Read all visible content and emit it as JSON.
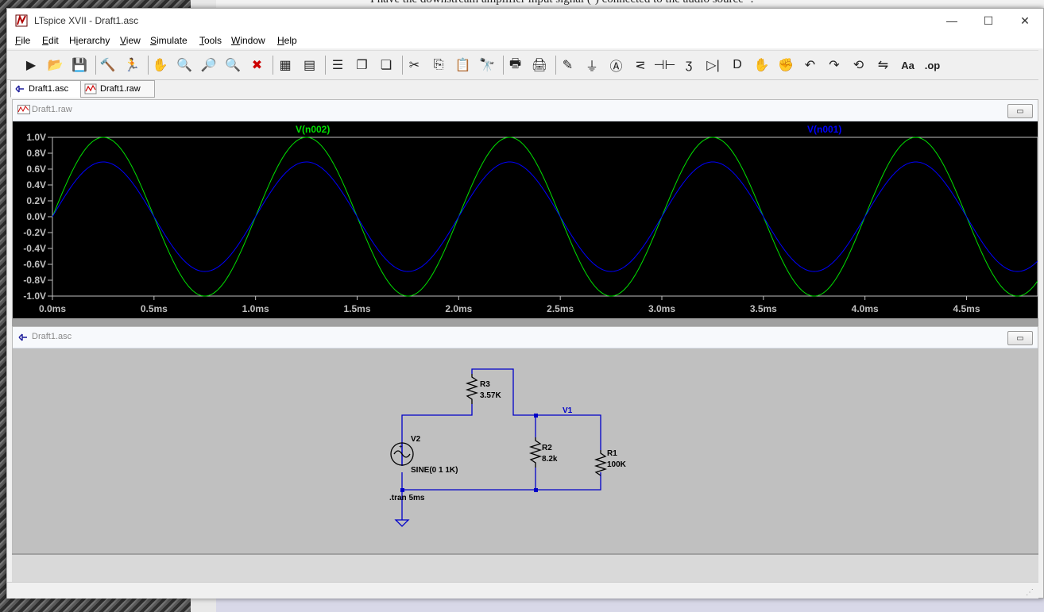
{
  "window": {
    "title": "LTspice XVII - Draft1.asc",
    "minimize": "—",
    "maximize": "☐",
    "close": "✕"
  },
  "background": {
    "page_text": "I have the downstream amplifier input signal (-) connected to the audio source -."
  },
  "menu": {
    "items": [
      {
        "label": "File",
        "key": "F"
      },
      {
        "label": "Edit",
        "key": "E"
      },
      {
        "label": "Hierarchy",
        "key": "i"
      },
      {
        "label": "View",
        "key": "V"
      },
      {
        "label": "Simulate",
        "key": "S"
      },
      {
        "label": "Tools",
        "key": "T"
      },
      {
        "label": "Window",
        "key": "W"
      },
      {
        "label": "Help",
        "key": "H"
      }
    ]
  },
  "toolbar": {
    "icons": [
      "run-icon",
      "open-folder-icon",
      "save-icon",
      "control-panel-icon",
      "halt-icon",
      "pan-hand-icon",
      "zoom-in-icon",
      "zoom-area-icon",
      "zoom-out-icon",
      "zoom-cancel-icon",
      "autorange-icon",
      "plot-settings-icon",
      "tile-horizontal-icon",
      "cascade-icon",
      "tile-vertical-icon",
      "cut-icon",
      "copy-icon",
      "paste-icon",
      "find-icon",
      "print-icon",
      "print-setup-icon",
      "wire-icon",
      "ground-icon",
      "label-net-icon",
      "resistor-icon",
      "capacitor-icon",
      "inductor-icon",
      "diode-icon",
      "component-icon",
      "move-icon",
      "drag-icon",
      "undo-icon",
      "redo-icon",
      "rotate-icon",
      "mirror-icon",
      "text-icon",
      "spice-directive-icon"
    ],
    "spice_label": ".op",
    "text_label": "Aa"
  },
  "tabs": [
    {
      "label": "Draft1.asc",
      "active": true
    },
    {
      "label": "Draft1.raw",
      "active": false
    }
  ],
  "plot_window": {
    "title": "Draft1.raw",
    "restore_label": "▭"
  },
  "schematic_window": {
    "title": "Draft1.asc",
    "restore_label": "▭"
  },
  "chart_data": {
    "type": "line",
    "series": [
      {
        "name": "V(n002)",
        "color": "#00e000",
        "amplitude": 1.0,
        "frequency_khz": 1.0
      },
      {
        "name": "V(n001)",
        "color": "#0000ff",
        "amplitude": 0.69,
        "frequency_khz": 1.0
      }
    ],
    "x_ticks": [
      "0.0ms",
      "0.5ms",
      "1.0ms",
      "1.5ms",
      "2.0ms",
      "2.5ms",
      "3.0ms",
      "3.5ms",
      "4.0ms",
      "4.5ms"
    ],
    "y_ticks": [
      "1.0V",
      "0.8V",
      "0.6V",
      "0.4V",
      "0.2V",
      "0.0V",
      "-0.2V",
      "-0.4V",
      "-0.6V",
      "-0.8V",
      "-1.0V"
    ],
    "xlim": [
      0,
      4.85
    ],
    "ylim": [
      -1.0,
      1.0
    ],
    "tick_color": "#c0c0c0"
  },
  "schematic": {
    "R3": {
      "name": "R3",
      "value": "3.57K"
    },
    "R2": {
      "name": "R2",
      "value": "8.2k"
    },
    "R1": {
      "name": "R1",
      "value": "100K"
    },
    "V2": {
      "name": "V2",
      "value": "SINE(0 1 1K)"
    },
    "net_label": "V1",
    "directive": ".tran 5ms",
    "wire_color": "#0000c8",
    "text_color": "#000000"
  }
}
